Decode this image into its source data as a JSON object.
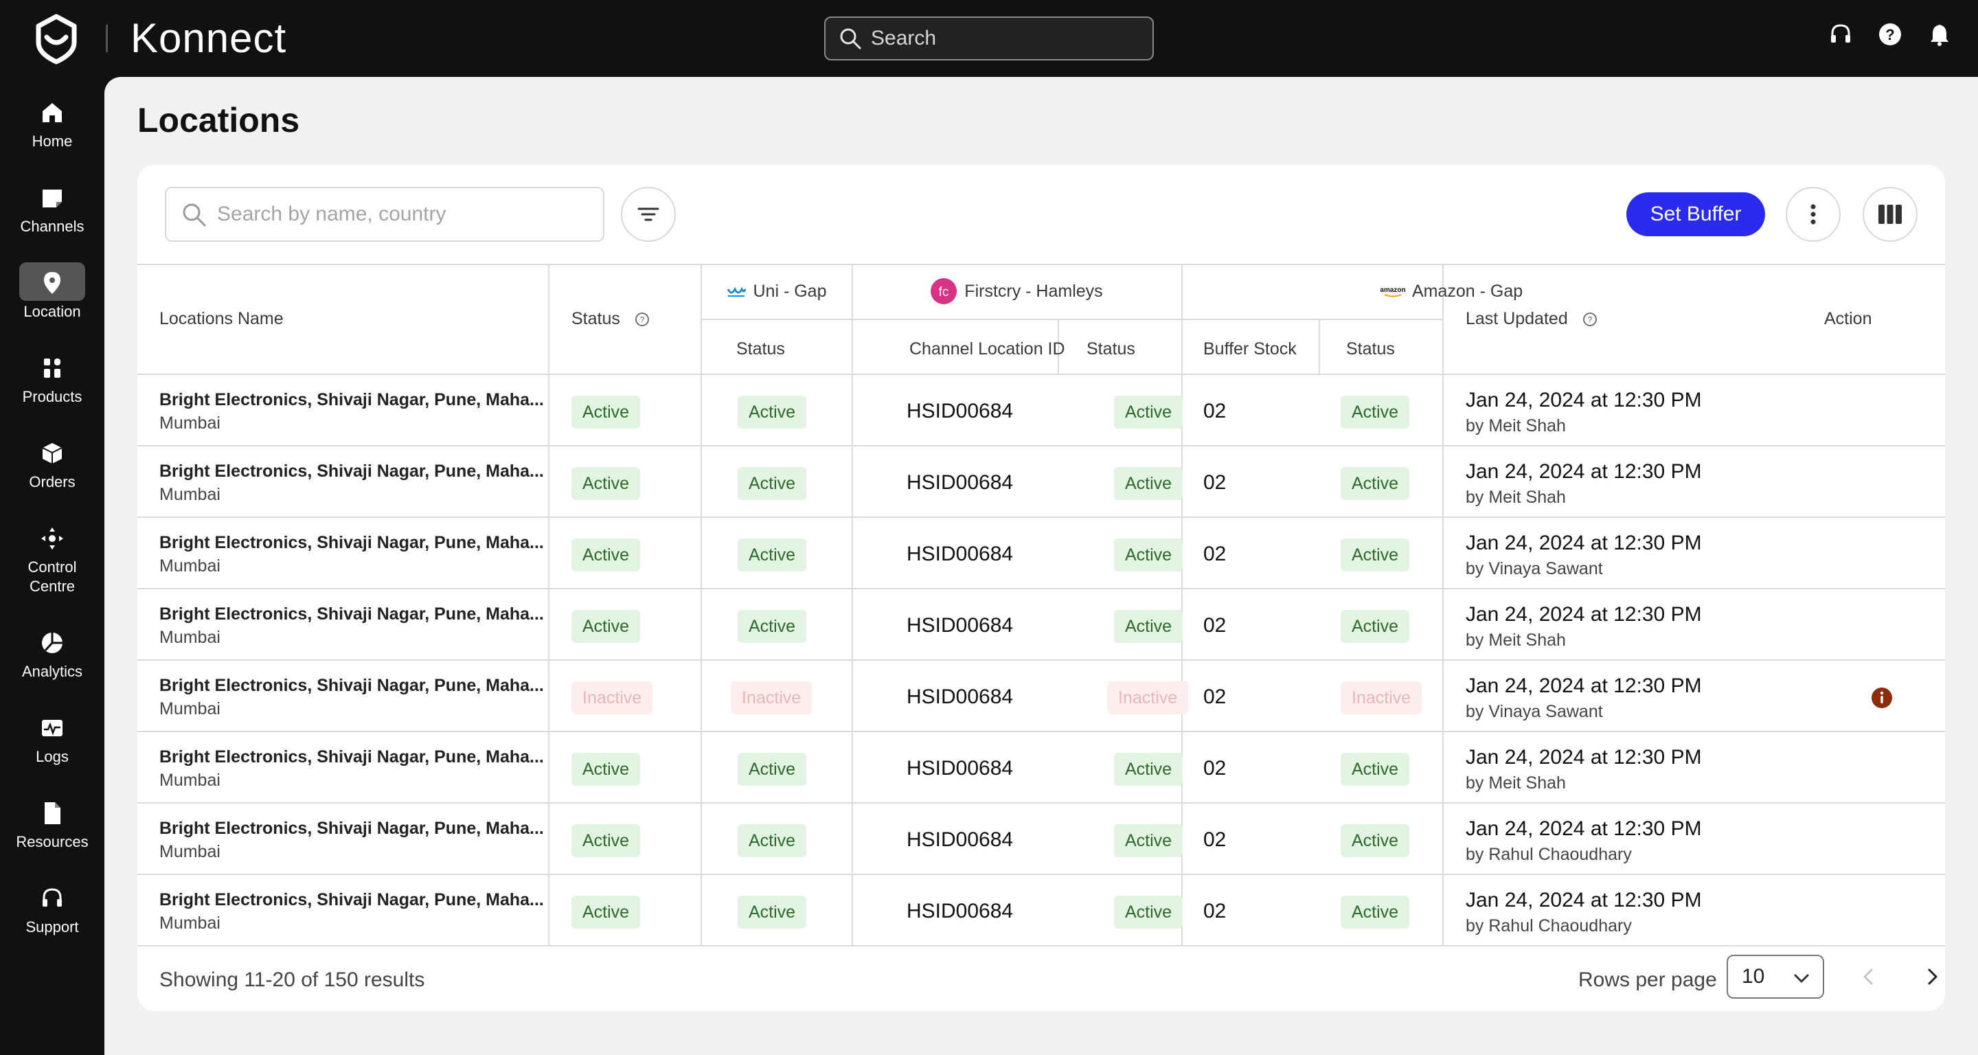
{
  "app": {
    "brand": "Konnect"
  },
  "topbar": {
    "search_placeholder": "Search",
    "icons": [
      "headset-icon",
      "help-icon",
      "bell-icon"
    ]
  },
  "sidebar": {
    "items": [
      {
        "label": "Home",
        "icon": "home-icon",
        "active": false
      },
      {
        "label": "Channels",
        "icon": "channels-icon",
        "active": false
      },
      {
        "label": "Location",
        "icon": "location-pin-icon",
        "active": true
      },
      {
        "label": "Products",
        "icon": "products-icon",
        "active": false
      },
      {
        "label": "Orders",
        "icon": "box-icon",
        "active": false
      },
      {
        "label": "Control\nCentre",
        "label_line1": "Control",
        "label_line2": "Centre",
        "icon": "control-centre-icon",
        "active": false
      },
      {
        "label": "Analytics",
        "icon": "pie-chart-icon",
        "active": false
      },
      {
        "label": "Logs",
        "icon": "logs-icon",
        "active": false
      },
      {
        "label": "Resources",
        "icon": "document-icon",
        "active": false
      },
      {
        "label": "Support",
        "icon": "headset-icon",
        "active": false
      }
    ]
  },
  "page": {
    "title": "Locations"
  },
  "toolbar": {
    "search_placeholder": "Search by name, country",
    "set_buffer_label": "Set Buffer"
  },
  "table": {
    "headers": {
      "name": "Locations Name",
      "status": "Status",
      "last_updated": "Last Updated",
      "action": "Action"
    },
    "groups": {
      "uni": {
        "label": "Uni - Gap",
        "sub": [
          "Status"
        ]
      },
      "firstcry": {
        "label": "Firstcry - Hamleys",
        "sub": [
          "Channel Location ID",
          "Status"
        ]
      },
      "amazon": {
        "label": "Amazon - Gap",
        "sub": [
          "Buffer Stock",
          "Status"
        ]
      }
    },
    "rows": [
      {
        "name": "Bright Electronics, Shivaji Nagar, Pune, Maha...",
        "city": "Mumbai",
        "status": "Active",
        "uni_status": "Active",
        "fc_id": "HSID00684",
        "fc_status": "Active",
        "buffer": "02",
        "amz_status": "Active",
        "updated": "Jan 24, 2024 at 12:30 PM",
        "by": "by Meit Shah",
        "warning": false
      },
      {
        "name": "Bright Electronics, Shivaji Nagar, Pune, Maha...",
        "city": "Mumbai",
        "status": "Active",
        "uni_status": "Active",
        "fc_id": "HSID00684",
        "fc_status": "Active",
        "buffer": "02",
        "amz_status": "Active",
        "updated": "Jan 24, 2024 at 12:30 PM",
        "by": "by Meit Shah",
        "warning": false
      },
      {
        "name": "Bright Electronics, Shivaji Nagar, Pune, Maha...",
        "city": "Mumbai",
        "status": "Active",
        "uni_status": "Active",
        "fc_id": "HSID00684",
        "fc_status": "Active",
        "buffer": "02",
        "amz_status": "Active",
        "updated": "Jan 24, 2024 at 12:30 PM",
        "by": "by Vinaya Sawant",
        "warning": false
      },
      {
        "name": "Bright Electronics, Shivaji Nagar, Pune, Maha...",
        "city": "Mumbai",
        "status": "Active",
        "uni_status": "Active",
        "fc_id": "HSID00684",
        "fc_status": "Active",
        "buffer": "02",
        "amz_status": "Active",
        "updated": "Jan 24, 2024 at 12:30 PM",
        "by": "by Meit Shah",
        "warning": false
      },
      {
        "name": "Bright Electronics, Shivaji Nagar, Pune, Maha...",
        "city": "Mumbai",
        "status": "Inactive",
        "uni_status": "Inactive",
        "fc_id": "HSID00684",
        "fc_status": "Inactive",
        "buffer": "02",
        "amz_status": "Inactive",
        "updated": "Jan 24, 2024 at 12:30 PM",
        "by": "by Vinaya Sawant",
        "warning": true
      },
      {
        "name": "Bright Electronics, Shivaji Nagar, Pune, Maha...",
        "city": "Mumbai",
        "status": "Active",
        "uni_status": "Active",
        "fc_id": "HSID00684",
        "fc_status": "Active",
        "buffer": "02",
        "amz_status": "Active",
        "updated": "Jan 24, 2024 at 12:30 PM",
        "by": "by Meit Shah",
        "warning": false
      },
      {
        "name": "Bright Electronics, Shivaji Nagar, Pune, Maha...",
        "city": "Mumbai",
        "status": "Active",
        "uni_status": "Active",
        "fc_id": "HSID00684",
        "fc_status": "Active",
        "buffer": "02",
        "amz_status": "Active",
        "updated": "Jan 24, 2024 at 12:30 PM",
        "by": "by Rahul Chaoudhary",
        "warning": false
      },
      {
        "name": "Bright Electronics, Shivaji Nagar, Pune, Maha...",
        "city": "Mumbai",
        "status": "Active",
        "uni_status": "Active",
        "fc_id": "HSID00684",
        "fc_status": "Active",
        "buffer": "02",
        "amz_status": "Active",
        "updated": "Jan 24, 2024 at 12:30 PM",
        "by": "by Rahul Chaoudhary",
        "warning": false
      }
    ]
  },
  "footer": {
    "showing": "Showing 11-20 of 150 results",
    "rows_per_page_label": "Rows per page",
    "rows_per_page_value": "10"
  },
  "colors": {
    "primary": "#2b2bf0",
    "active_bg": "#e3f4e2",
    "active_text": "#2b6a2b",
    "inactive_bg": "#fdeeee",
    "inactive_text": "#ebb6b6",
    "warning": "#8b2d0b"
  }
}
